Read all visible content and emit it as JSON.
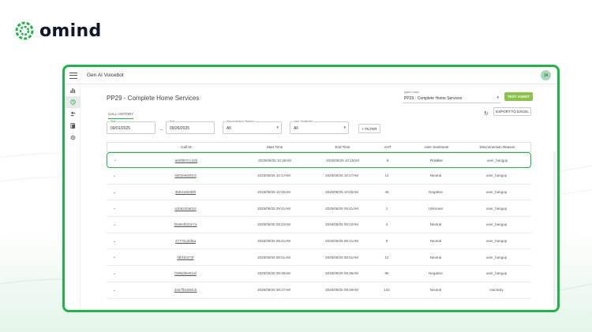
{
  "brand": {
    "name": "omind",
    "color": "#22b14c"
  },
  "app": {
    "title": "Gen AI Voicebot",
    "user_initials": "JA"
  },
  "sidebar": {
    "items": [
      {
        "icon": "bar-chart-icon",
        "active": false
      },
      {
        "icon": "history-icon",
        "active": true
      },
      {
        "icon": "users-icon",
        "active": false
      },
      {
        "icon": "report-icon",
        "active": false
      },
      {
        "icon": "gear-icon",
        "active": false
      }
    ]
  },
  "page": {
    "title": "PP29 - Complete Home Services",
    "agent_label": "Agent name",
    "agent_value": "PP29 - Complete Home Services",
    "test_agent_label": "TEST AGENT",
    "tab_label": "CALL HISTORY",
    "export_label": "EXPORT TO EXCEL"
  },
  "filters": {
    "start_label": "Start",
    "start_value": "09/01/2025",
    "end_label": "End",
    "end_value": "09/26/2025",
    "disconnection_label": "Disconnection Reason",
    "disconnection_value": "All",
    "sentiment_label": "User Sentiment",
    "sentiment_value": "All",
    "filter_label": "+ FILTER"
  },
  "table": {
    "headers": {
      "call_id": "Call ID",
      "start_time": "Start Time",
      "end_time": "End Time",
      "aht": "AHT",
      "sentiment": "User Sentiment",
      "reason": "Disconnection Reason"
    },
    "rows": [
      {
        "call_id": "a60f807cc42b",
        "start": "2025/09/25 10:18AM",
        "end": "2025/09/25 10:18AM",
        "aht": "8",
        "sentiment": "Positive",
        "reason": "user_hangup"
      },
      {
        "call_id": "0d03e6d40c3",
        "start": "2025/09/25 10:17AM",
        "end": "2025/09/25 10:17AM",
        "aht": "14",
        "sentiment": "Neutral",
        "reason": "user_hangup"
      },
      {
        "call_id": "3b5319e0bf0",
        "start": "2025/09/25 10:00AM",
        "end": "2025/09/25 10:00AM",
        "aht": "46",
        "sentiment": "Negative",
        "reason": "user_hangup"
      },
      {
        "call_id": "a1b6240a014",
        "start": "2025/09/25 09:41AM",
        "end": "2025/09/25 09:41AM",
        "aht": "1",
        "sentiment": "Unknown",
        "reason": "user_hangup"
      },
      {
        "call_id": "f2a0e4b22e7a",
        "start": "2025/09/25 09:22AM",
        "end": "2025/09/25 09:22AM",
        "aht": "4",
        "sentiment": "Neutral",
        "reason": "user_hangup"
      },
      {
        "call_id": "27770c2bf5a",
        "start": "2025/09/25 09:21AM",
        "end": "2025/09/25 09:21AM",
        "aht": "9",
        "sentiment": "Neutral",
        "reason": "user_hangup"
      },
      {
        "call_id": "fdbf1b373f",
        "start": "2025/09/25 08:51AM",
        "end": "2025/09/25 08:51AM",
        "aht": "12",
        "sentiment": "Neutral",
        "reason": "user_hangup"
      },
      {
        "call_id": "f3d5d3be51af",
        "start": "2025/09/25 08:38AM",
        "end": "2025/09/25 08:38AM",
        "aht": "86",
        "sentiment": "Negative",
        "reason": "user_hangup"
      },
      {
        "call_id": "34a7fb1864cb",
        "start": "2025/09/25 08:27AM",
        "end": "2025/09/25 08:29AM",
        "aht": "142",
        "sentiment": "Neutral",
        "reason": "inactivity"
      }
    ]
  }
}
